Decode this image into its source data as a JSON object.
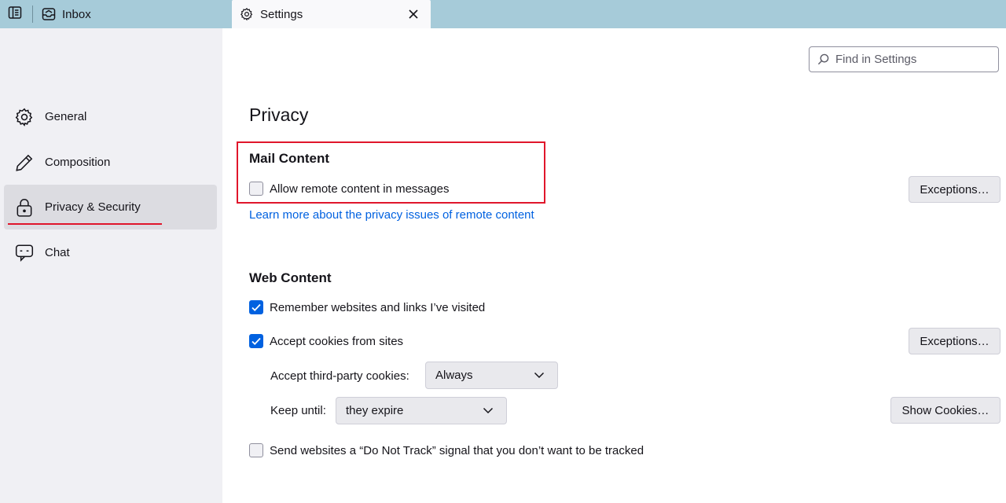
{
  "tabs": {
    "inbox_label": "Inbox",
    "settings_label": "Settings"
  },
  "sidebar": {
    "items": [
      {
        "label": "General",
        "icon": "gear-icon"
      },
      {
        "label": "Composition",
        "icon": "pencil-icon"
      },
      {
        "label": "Privacy & Security",
        "icon": "lock-icon",
        "selected": true
      },
      {
        "label": "Chat",
        "icon": "chat-bubble-icon"
      }
    ]
  },
  "search": {
    "placeholder": "Find in Settings"
  },
  "privacy": {
    "title": "Privacy",
    "mail_content": {
      "heading": "Mail Content",
      "remote_content_label": "Allow remote content in messages",
      "remote_content_checked": false,
      "exceptions_label": "Exceptions…",
      "learn_more_link": "Learn more about the privacy issues of remote content"
    },
    "web_content": {
      "heading": "Web Content",
      "remember_label": "Remember websites and links I’ve visited",
      "remember_checked": true,
      "accept_cookies_label": "Accept cookies from sites",
      "accept_cookies_checked": true,
      "exceptions_label": "Exceptions…",
      "third_party_label": "Accept third-party cookies:",
      "third_party_value": "Always",
      "keep_until_label": "Keep until:",
      "keep_until_value": "they expire",
      "show_cookies_label": "Show Cookies…",
      "dnt_label": "Send websites a “Do Not Track” signal that you don’t want to be tracked",
      "dnt_checked": false
    }
  },
  "colors": {
    "tabstrip": "#a6cbd9",
    "sidebar": "#f0f0f4",
    "accent": "#0061e0",
    "highlight_red": "#e0162b"
  }
}
